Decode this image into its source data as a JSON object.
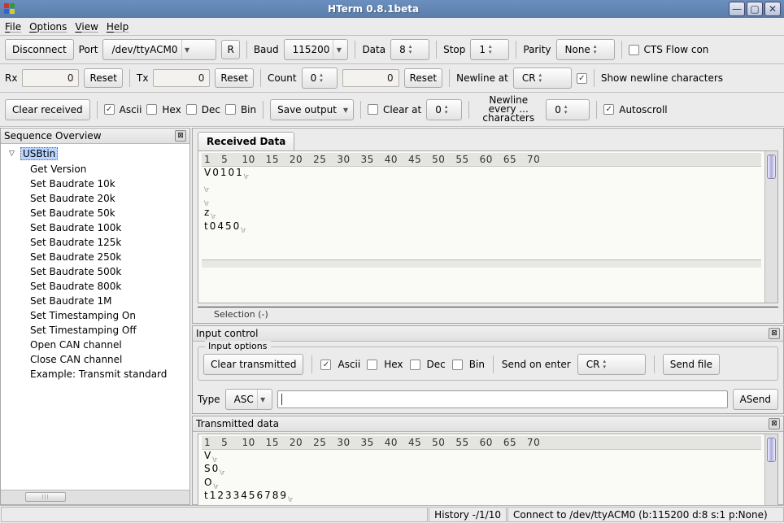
{
  "window": {
    "title": "HTerm 0.8.1beta"
  },
  "menu": {
    "file": "File",
    "options": "Options",
    "view": "View",
    "help": "Help"
  },
  "conn": {
    "disconnect": "Disconnect",
    "port_label": "Port",
    "port_value": "/dev/ttyACM0",
    "r_button": "R",
    "baud_label": "Baud",
    "baud_value": "115200",
    "data_label": "Data",
    "data_value": "8",
    "stop_label": "Stop",
    "stop_value": "1",
    "parity_label": "Parity",
    "parity_value": "None",
    "cts_label": "CTS Flow con"
  },
  "counters": {
    "rx_label": "Rx",
    "rx_value": "0",
    "rx_reset": "Reset",
    "tx_label": "Tx",
    "tx_value": "0",
    "tx_reset": "Reset",
    "count_label": "Count",
    "count_spin": "0",
    "count_total": "0",
    "count_reset": "Reset",
    "newline_at_label": "Newline at",
    "newline_at_value": "CR",
    "show_newline_label": "Show newline characters"
  },
  "row3": {
    "clear_received": "Clear received",
    "ascii": "Ascii",
    "hex": "Hex",
    "dec": "Dec",
    "bin": "Bin",
    "save_output": "Save output",
    "clear_at_label": "Clear at",
    "clear_at_value": "0",
    "newline_every_label": "Newline every ... characters",
    "newline_every_value": "0",
    "autoscroll": "Autoscroll"
  },
  "sidebar": {
    "title": "Sequence Overview",
    "root": "USBtin",
    "items": [
      "Get Version",
      "Set Baudrate 10k",
      "Set Baudrate 20k",
      "Set Baudrate 50k",
      "Set Baudrate 100k",
      "Set Baudrate 125k",
      "Set Baudrate 250k",
      "Set Baudrate 500k",
      "Set Baudrate 800k",
      "Set Baudrate 1M",
      "Set Timestamping On",
      "Set Timestamping Off",
      "Open CAN channel",
      "Close CAN channel",
      "Example: Transmit standard"
    ]
  },
  "received": {
    "tab": "Received Data",
    "ruler": "1   5    10   15   20   25   30   35   40   45   50   55   60   65   70",
    "lines": [
      "V0101",
      "",
      "",
      "z",
      "t0450"
    ],
    "selection": "Selection (-)"
  },
  "input": {
    "panel_title": "Input control",
    "options_title": "Input options",
    "clear_transmitted": "Clear transmitted",
    "ascii": "Ascii",
    "hex": "Hex",
    "dec": "Dec",
    "bin": "Bin",
    "send_on_enter_label": "Send on enter",
    "send_on_enter_value": "CR",
    "send_file": "Send file",
    "type_label": "Type",
    "type_value": "ASC",
    "asend": "ASend"
  },
  "transmitted": {
    "title": "Transmitted data",
    "ruler": "1   5    10   15   20   25   30   35   40   45   50   55   60   65   70",
    "lines": [
      "V",
      "S0",
      "O",
      "t1233456789"
    ]
  },
  "status": {
    "history": "History -/1/10",
    "conn": "Connect to /dev/ttyACM0 (b:115200 d:8 s:1 p:None)"
  }
}
